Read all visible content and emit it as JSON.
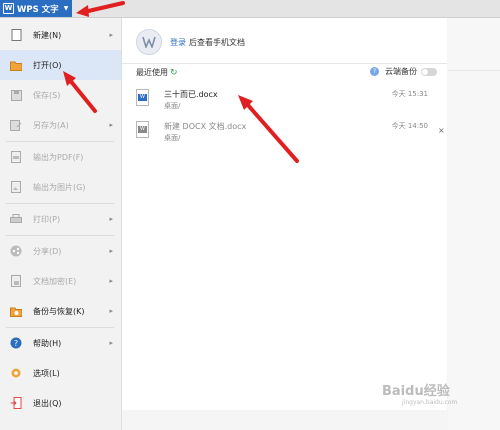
{
  "app": {
    "title": "WPS 文字"
  },
  "menu": [
    {
      "label": "新建(N)",
      "submenu": true,
      "disabled": false,
      "active": false,
      "icon": "new-doc-icon"
    },
    {
      "label": "打开(O)",
      "submenu": false,
      "disabled": false,
      "active": true,
      "icon": "folder-open-icon"
    },
    {
      "label": "保存(S)",
      "submenu": false,
      "disabled": true,
      "active": false,
      "icon": "save-icon"
    },
    {
      "label": "另存为(A)",
      "submenu": true,
      "disabled": true,
      "active": false,
      "icon": "save-as-icon"
    },
    {
      "label": "输出为PDF(F)",
      "submenu": false,
      "disabled": true,
      "active": false,
      "icon": "pdf-icon"
    },
    {
      "label": "输出为图片(G)",
      "submenu": false,
      "disabled": true,
      "active": false,
      "icon": "image-export-icon"
    },
    {
      "label": "打印(P)",
      "submenu": true,
      "disabled": true,
      "active": false,
      "icon": "print-icon"
    },
    {
      "label": "分享(D)",
      "submenu": true,
      "disabled": true,
      "active": false,
      "icon": "share-icon"
    },
    {
      "label": "文档加密(E)",
      "submenu": true,
      "disabled": true,
      "active": false,
      "icon": "lock-icon"
    },
    {
      "label": "备份与恢复(K)",
      "submenu": true,
      "disabled": false,
      "active": false,
      "icon": "backup-icon"
    },
    {
      "label": "帮助(H)",
      "submenu": true,
      "disabled": false,
      "active": false,
      "icon": "help-icon"
    },
    {
      "label": "选项(L)",
      "submenu": false,
      "disabled": false,
      "active": false,
      "icon": "gear-icon"
    },
    {
      "label": "退出(Q)",
      "submenu": false,
      "disabled": false,
      "active": false,
      "icon": "exit-icon"
    }
  ],
  "panel": {
    "login_link": "登录",
    "login_hint": "后查看手机文档",
    "recent_title": "最近使用",
    "cloud_label": "云端备份",
    "files": [
      {
        "name": "三十而已.docx",
        "path": "桌面/",
        "time": "今天 15:31"
      },
      {
        "name": "新建 DOCX 文档.docx",
        "path": "桌面/",
        "time": "今天 14:50"
      }
    ],
    "close_label": "×"
  },
  "watermark": {
    "text": "Baidu经验",
    "sub": "jingyan.baidu.com"
  },
  "colors": {
    "accent": "#2b6dc0",
    "arrow": "#e02020"
  }
}
